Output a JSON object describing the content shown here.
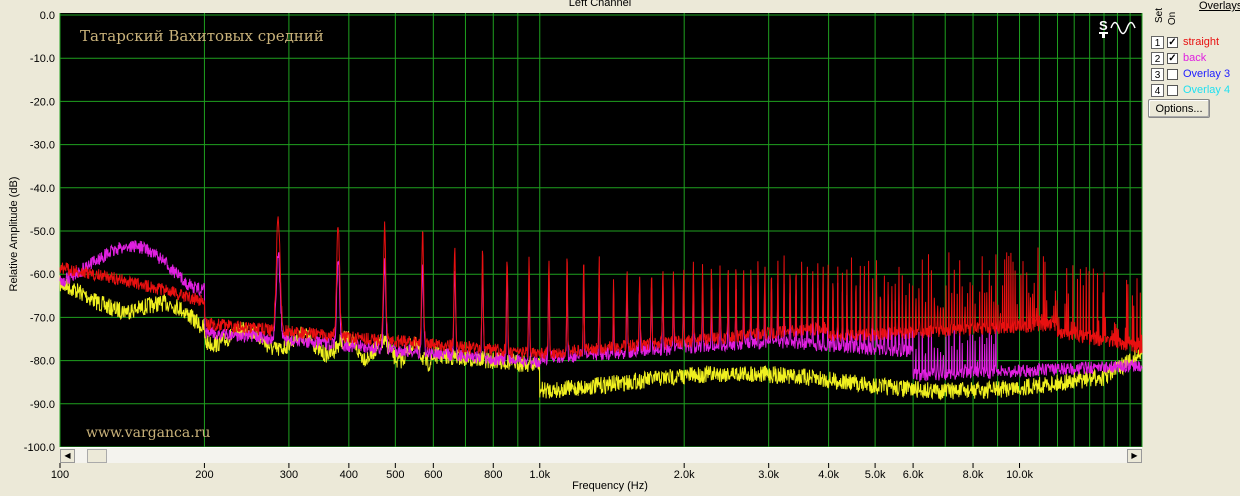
{
  "chart_data": {
    "type": "line",
    "title": "Left Channel",
    "xlabel": "Frequency (Hz)",
    "ylabel": "Relative Amplitude (dB)",
    "x_scale": "log",
    "xlim": [
      100,
      18000
    ],
    "ylim": [
      -100,
      0
    ],
    "grid": true,
    "y_ticks": [
      "0.0",
      "-10.0",
      "-20.0",
      "-30.0",
      "-40.0",
      "-50.0",
      "-60.0",
      "-70.0",
      "-80.0",
      "-90.0",
      "-100.0"
    ],
    "x_ticks": [
      "100",
      "200",
      "300",
      "400",
      "500",
      "600",
      "800",
      "1.0k",
      "2.0k",
      "3.0k",
      "4.0k",
      "5.0k",
      "6.0k",
      "8.0k",
      "10.0k"
    ],
    "annotations": [
      "Татарский Вахитовых средний",
      "www.varganca.ru"
    ],
    "series": [
      {
        "name": "straight",
        "color": "#e81010"
      },
      {
        "name": "back",
        "color": "#e020e0"
      },
      {
        "color": "#f0f020"
      }
    ]
  },
  "overlays": {
    "header_set": "Set",
    "header_on": "On",
    "header_title": "Overlays",
    "items": [
      {
        "num": "1",
        "checked": true,
        "name": "straight",
        "color": "#e81010"
      },
      {
        "num": "2",
        "checked": true,
        "name": "back",
        "color": "#e020e0"
      },
      {
        "num": "3",
        "checked": false,
        "name": "Overlay 3",
        "color": "#2020ff"
      },
      {
        "num": "4",
        "checked": false,
        "name": "Overlay 4",
        "color": "#20e0f0"
      }
    ],
    "options_label": "Options..."
  },
  "logo_text": "S"
}
